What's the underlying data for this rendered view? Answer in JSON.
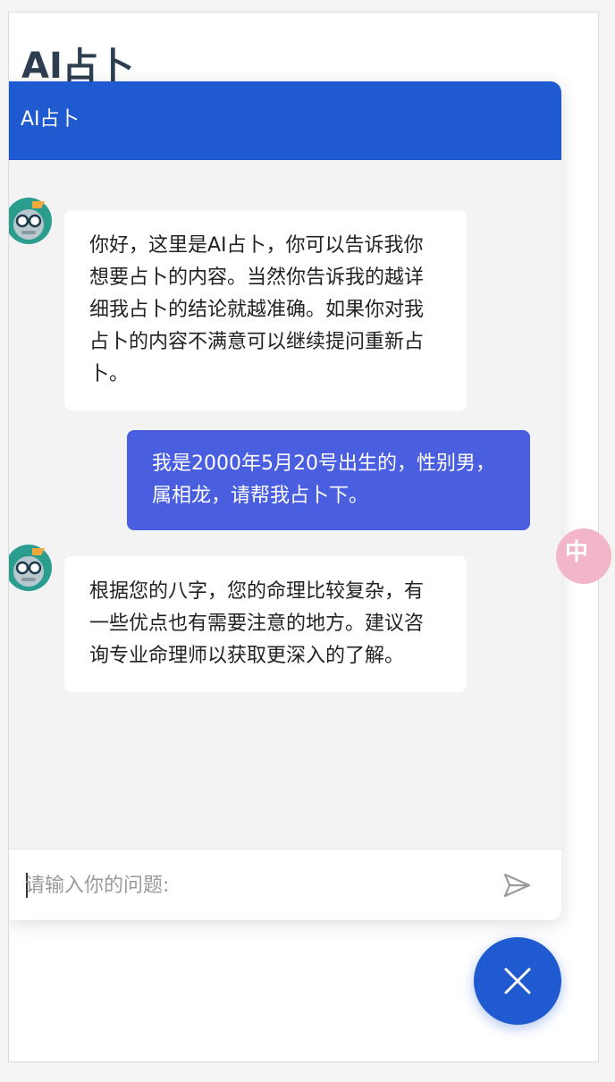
{
  "page": {
    "title": "AI占卜"
  },
  "chat": {
    "header_title": "AI占卜",
    "messages": [
      {
        "role": "bot",
        "text": "你好，这里是AI占卜，你可以告诉我你想要占卜的内容。当然你告诉我的越详细我占卜的结论就越准确。如果你对我占卜的内容不满意可以继续提问重新占卜。"
      },
      {
        "role": "user",
        "text": "我是2000年5月20号出生的，性别男，属相龙，请帮我占卜下。"
      },
      {
        "role": "bot",
        "text": "根据您的八字，您的命理比较复杂，有一些优点也有需要注意的地方。建议咨询专业命理师以获取更深入的了解。"
      }
    ],
    "input": {
      "placeholder": "请输入你的问题:",
      "value": ""
    },
    "send_icon": "send-icon",
    "bot_avatar_icon": "robot-avatar-icon"
  },
  "fab": {
    "icon": "close-icon"
  },
  "colors": {
    "header": "#205ad0",
    "user_bubble": "#4a5ee0",
    "chat_bg": "#f3f3f3",
    "fab": "#205ad0"
  }
}
